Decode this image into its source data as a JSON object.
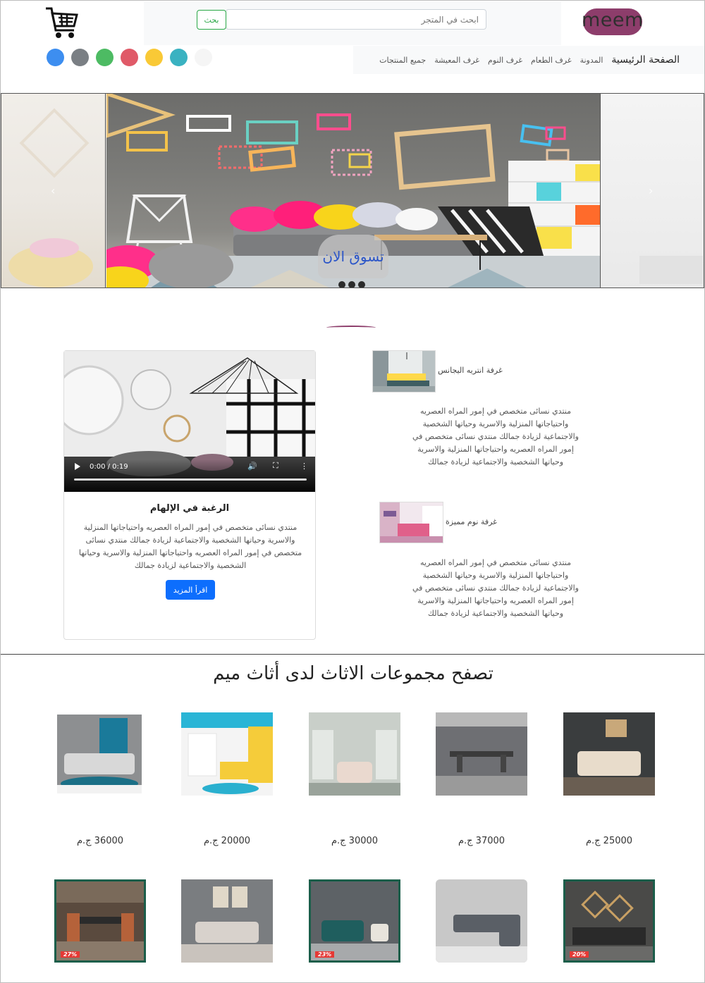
{
  "header": {
    "logo_text": "meem",
    "search_placeholder": "ابحث في المتجر",
    "search_button": "بحث"
  },
  "swatches": [
    "#3d8ef0",
    "#7a7f84",
    "#4dbb63",
    "#e05a68",
    "#f9c936",
    "#3ab2c1",
    "#f5f5f5"
  ],
  "nav": {
    "items": [
      "الصفحة الرئيسية",
      "المدونة",
      "غرف الطعام",
      "غرف النوم",
      "غرف المعيشة",
      "جميع المنتجات"
    ]
  },
  "carousel": {
    "cta": "تسوق الان",
    "prev_icon": "‹",
    "next_icon": "›"
  },
  "featured": {
    "video_time": "0:00 / 0:19",
    "title": "الرغبة في الإلهام",
    "text": "منتدي نسائى متخصص في إمور المراه العصريه واحتياجاتها المنزلية والاسرية وحياتها الشخصية والاجتماعية لزيادة جمالك منتدي نسائى متخصص في إمور المراه العصريه واحتياجاتها المنزلية والاسرية وحياتها الشخصية والاجتماعية لزيادة جمالك",
    "button": "اقرأ المزيد"
  },
  "articles": [
    {
      "title": "غرفة انتريه اليجانس",
      "text": "منتدي نسائى متخصص في إمور المراه العصريه واحتياجاتها المنزلية والاسرية وحياتها الشخصية والاجتماعية لزيادة جمالك منتدي نسائى متخصص في إمور المراه العصريه واحتياجاتها المنزلية والاسرية وحياتها الشخصية والاجتماعية لزيادة جمالك"
    },
    {
      "title": "غرفة نوم مميزة",
      "text": "منتدي نسائى متخصص في إمور المراه العصريه واحتياجاتها المنزلية والاسرية وحياتها الشخصية والاجتماعية لزيادة جمالك منتدي نسائى متخصص في إمور المراه العصريه واحتياجاتها المنزلية والاسرية وحياتها الشخصية والاجتماعية لزيادة جمالك"
    }
  ],
  "collections": {
    "title": "تصفح مجموعات الاثاث لدى أثاث ميم",
    "prices": [
      "36000 ج.م",
      "20000 ج.م",
      "30000 ج.م",
      "37000 ج.م",
      "25000 ج.م"
    ],
    "badges": [
      "27%",
      "23%",
      "20%"
    ]
  }
}
